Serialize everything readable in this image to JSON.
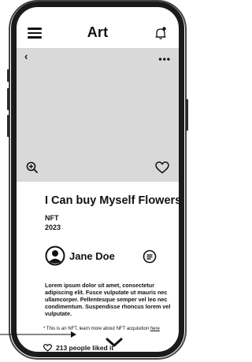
{
  "header": {
    "title": "Art"
  },
  "artwork": {
    "title": "I Can buy Myself Flowers",
    "type": "NFT",
    "year": "2023"
  },
  "artist": {
    "name": "Jane Doe"
  },
  "description": "Lorem ipsum dolor sit amet, consectetur adipiscing elit. Fusce vulputate ut mauris nec ullamcorper. Pellentesque semper vel leo nec condimentum. Suspendisse rhoncus lorem vel vulputate.",
  "nft_note": {
    "text": "* This is an NFT, learn more about NFT acquisition ",
    "link": "here"
  },
  "likes": {
    "text": "213 people liked it"
  },
  "icons": {
    "menu": "hamburger-icon",
    "notifications": "bell-icon",
    "back": "chevron-left-icon",
    "more": "more-dots-icon",
    "zoom": "zoom-in-icon",
    "like": "heart-icon",
    "avatar": "user-avatar-icon",
    "message": "message-icon",
    "expand": "chevron-down-icon"
  }
}
